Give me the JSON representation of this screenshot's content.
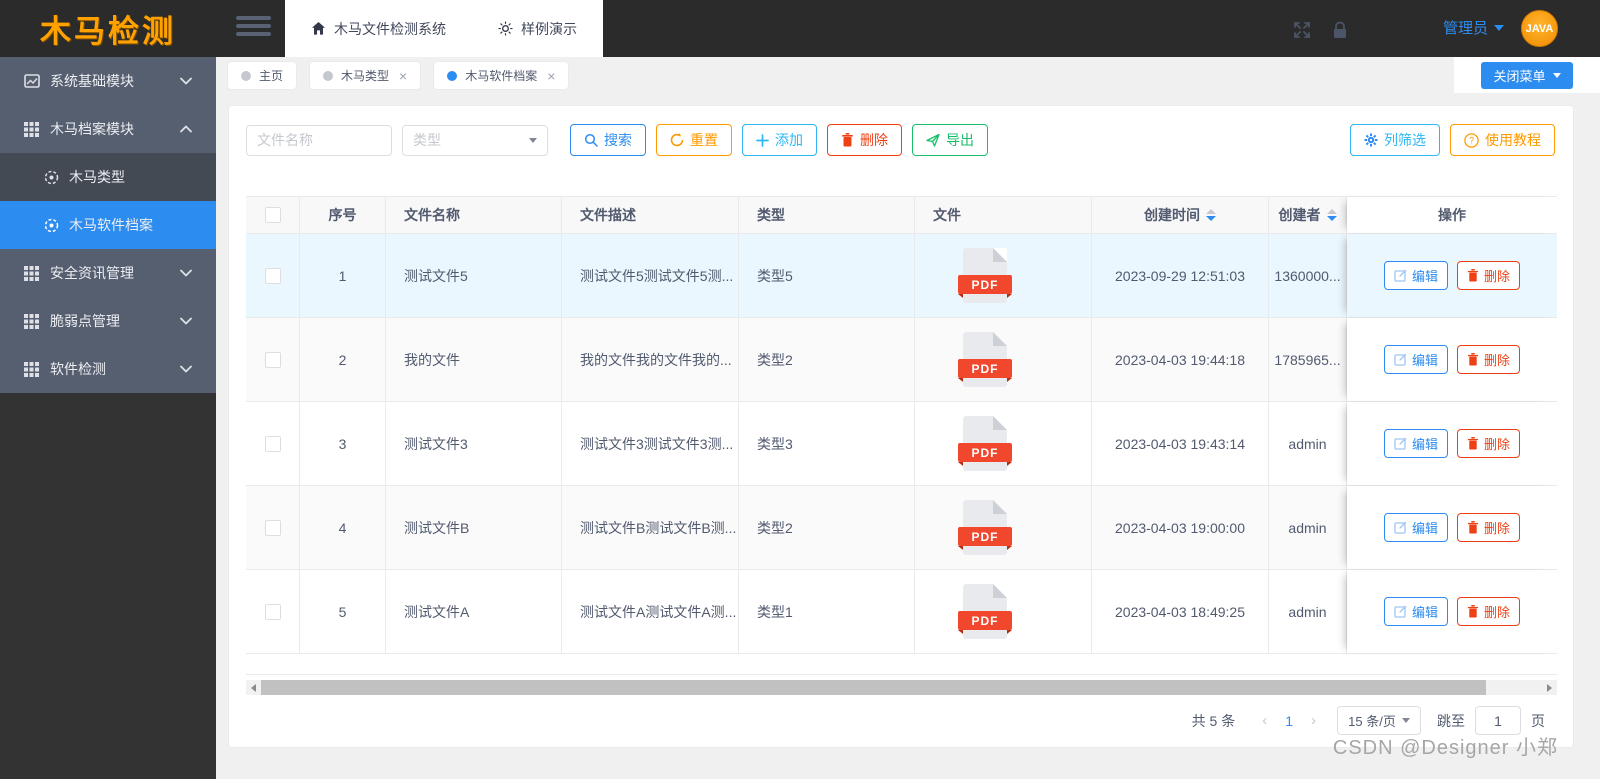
{
  "logo": "木马检测",
  "topbar": {
    "app_title": "木马文件检测系统",
    "demo_label": "样例演示",
    "user_role": "管理员",
    "avatar_text": "JAVA",
    "close_menu_label": "关闭菜单"
  },
  "sidebar": {
    "items": [
      {
        "label": "系统基础模块"
      },
      {
        "label": "木马档案模块"
      },
      {
        "label": "木马类型"
      },
      {
        "label": "木马软件档案"
      },
      {
        "label": "安全资讯管理"
      },
      {
        "label": "脆弱点管理"
      },
      {
        "label": "软件检测"
      }
    ]
  },
  "tabs": [
    {
      "label": "主页"
    },
    {
      "label": "木马类型"
    },
    {
      "label": "木马软件档案"
    }
  ],
  "filters": {
    "name_placeholder": "文件名称",
    "type_placeholder": "类型",
    "search_label": "搜索",
    "reset_label": "重置",
    "add_label": "添加",
    "delete_label": "删除",
    "export_label": "导出",
    "column_filter_label": "列筛选",
    "tutorial_label": "使用教程"
  },
  "table": {
    "headers": {
      "index": "序号",
      "name": "文件名称",
      "desc": "文件描述",
      "type": "类型",
      "file": "文件",
      "created": "创建时间",
      "creator": "创建者",
      "actions": "操作"
    },
    "pdf_label": "PDF",
    "edit_label": "编辑",
    "delete_label": "删除",
    "rows": [
      {
        "no": "1",
        "name": "测试文件5",
        "desc": "测试文件5测试文件5测...",
        "type": "类型5",
        "created": "2023-09-29 12:51:03",
        "creator": "1360000..."
      },
      {
        "no": "2",
        "name": "我的文件",
        "desc": "我的文件我的文件我的...",
        "type": "类型2",
        "created": "2023-04-03 19:44:18",
        "creator": "1785965..."
      },
      {
        "no": "3",
        "name": "测试文件3",
        "desc": "测试文件3测试文件3测...",
        "type": "类型3",
        "created": "2023-04-03 19:43:14",
        "creator": "admin"
      },
      {
        "no": "4",
        "name": "测试文件B",
        "desc": "测试文件B测试文件B测...",
        "type": "类型2",
        "created": "2023-04-03 19:00:00",
        "creator": "admin"
      },
      {
        "no": "5",
        "name": "测试文件A",
        "desc": "测试文件A测试文件A测...",
        "type": "类型1",
        "created": "2023-04-03 18:49:25",
        "creator": "admin"
      }
    ]
  },
  "pagination": {
    "total_label": "共 5 条",
    "prev": "‹",
    "next": "›",
    "current_page": "1",
    "page_size_label": "15 条/页",
    "jump_prefix": "跳至",
    "jump_value": "1",
    "jump_suffix": "页"
  },
  "watermark": "CSDN @Designer 小郑",
  "colors": {
    "primary": "#2d8cf0",
    "sky": "#2db7f5",
    "warning": "#ff9900",
    "danger": "#ed4014",
    "success": "#19be6b",
    "sidebar_bg": "#565f70",
    "sidebar_sub_bg": "#444a54",
    "topbar_bg": "#2b2b2b",
    "logo_orange": "#ffa200",
    "pdf_ribbon": "#f1472d",
    "row_highlight": "#eaf7fe"
  }
}
